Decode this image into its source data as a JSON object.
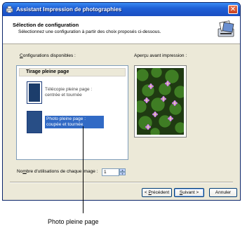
{
  "window": {
    "title": "Assistant Impression de photographies",
    "close_glyph": "✕"
  },
  "header": {
    "title": "Sélection de configuration",
    "subtitle": "Sélectionnez une configuration à partir des choix proposés ci-dessous."
  },
  "labels": {
    "configs_prefix": "C",
    "configs_rest": "onfigurations disponibles :",
    "preview": "Aperçu avant impression :",
    "count_pre": "No",
    "count_u": "m",
    "count_post": "bre d'utilisations de chaque image :"
  },
  "list": {
    "header": "Tirage pleine page",
    "items": [
      {
        "line1": "Télécopie pleine page :",
        "line2": "centrée et tournée"
      },
      {
        "line1": "Photo pleine page :",
        "line2": "coupée et tournée"
      }
    ]
  },
  "count_value": "1",
  "buttons": {
    "back_pre": "< ",
    "back_u": "P",
    "back_rest": "récédent",
    "next_u": "S",
    "next_rest": "uivant >",
    "cancel": "Annuler"
  },
  "callout": "Photo pleine page",
  "colors": {
    "titlebar": "#1f5fd6",
    "selection": "#316ac5",
    "dialog_bg": "#ece9d8"
  }
}
